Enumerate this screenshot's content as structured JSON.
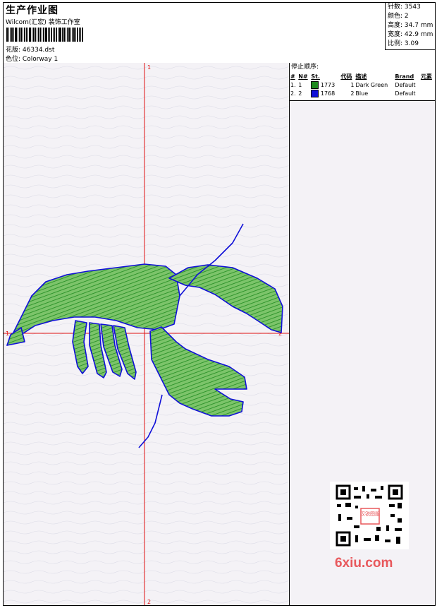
{
  "header": {
    "title": "生产作业图",
    "company": "Wilcom(汇宏) 装饰工作室",
    "file_label": "花版:",
    "file_value": "46334.dst",
    "colorway_label": "色位:",
    "colorway_value": "Colorway 1"
  },
  "stats": [
    {
      "label": "针数:",
      "value": "3543"
    },
    {
      "label": "颜色:",
      "value": "2"
    },
    {
      "label": "高度:",
      "value": "34.7 mm"
    },
    {
      "label": "宽度:",
      "value": "42.9 mm"
    },
    {
      "label": "比例:",
      "value": "3.09"
    }
  ],
  "axis_labels": {
    "top": "1",
    "bottom": "2",
    "left": "1",
    "right": "2"
  },
  "stop_sequence": {
    "title": "停止顺序:",
    "columns": [
      "#",
      "N#",
      "St.",
      "代码",
      "描述",
      "Brand",
      "元素"
    ],
    "rows": [
      {
        "index": "1.",
        "n": "1",
        "color": "#1e8a1e",
        "stitches": "1773",
        "code": "1",
        "desc": "Dark Green",
        "brand": "Default",
        "element": ""
      },
      {
        "index": "2.",
        "n": "2",
        "color": "#1010d8",
        "stitches": "1768",
        "code": "2",
        "desc": "Blue",
        "brand": "Default",
        "element": ""
      }
    ]
  },
  "watermark": "6xiu.com",
  "qr_badge": "汉锐图版"
}
